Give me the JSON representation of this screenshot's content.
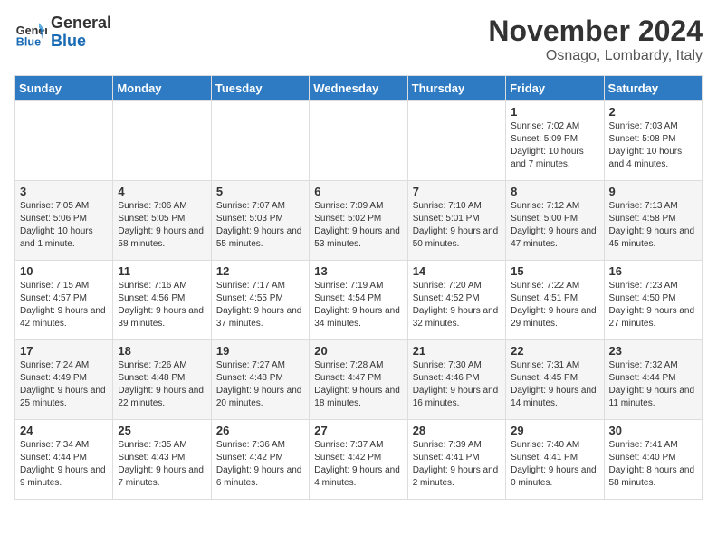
{
  "header": {
    "logo_general": "General",
    "logo_blue": "Blue",
    "month_title": "November 2024",
    "location": "Osnago, Lombardy, Italy"
  },
  "weekdays": [
    "Sunday",
    "Monday",
    "Tuesday",
    "Wednesday",
    "Thursday",
    "Friday",
    "Saturday"
  ],
  "weeks": [
    [
      {
        "day": "",
        "info": ""
      },
      {
        "day": "",
        "info": ""
      },
      {
        "day": "",
        "info": ""
      },
      {
        "day": "",
        "info": ""
      },
      {
        "day": "",
        "info": ""
      },
      {
        "day": "1",
        "info": "Sunrise: 7:02 AM\nSunset: 5:09 PM\nDaylight: 10 hours and 7 minutes."
      },
      {
        "day": "2",
        "info": "Sunrise: 7:03 AM\nSunset: 5:08 PM\nDaylight: 10 hours and 4 minutes."
      }
    ],
    [
      {
        "day": "3",
        "info": "Sunrise: 7:05 AM\nSunset: 5:06 PM\nDaylight: 10 hours and 1 minute."
      },
      {
        "day": "4",
        "info": "Sunrise: 7:06 AM\nSunset: 5:05 PM\nDaylight: 9 hours and 58 minutes."
      },
      {
        "day": "5",
        "info": "Sunrise: 7:07 AM\nSunset: 5:03 PM\nDaylight: 9 hours and 55 minutes."
      },
      {
        "day": "6",
        "info": "Sunrise: 7:09 AM\nSunset: 5:02 PM\nDaylight: 9 hours and 53 minutes."
      },
      {
        "day": "7",
        "info": "Sunrise: 7:10 AM\nSunset: 5:01 PM\nDaylight: 9 hours and 50 minutes."
      },
      {
        "day": "8",
        "info": "Sunrise: 7:12 AM\nSunset: 5:00 PM\nDaylight: 9 hours and 47 minutes."
      },
      {
        "day": "9",
        "info": "Sunrise: 7:13 AM\nSunset: 4:58 PM\nDaylight: 9 hours and 45 minutes."
      }
    ],
    [
      {
        "day": "10",
        "info": "Sunrise: 7:15 AM\nSunset: 4:57 PM\nDaylight: 9 hours and 42 minutes."
      },
      {
        "day": "11",
        "info": "Sunrise: 7:16 AM\nSunset: 4:56 PM\nDaylight: 9 hours and 39 minutes."
      },
      {
        "day": "12",
        "info": "Sunrise: 7:17 AM\nSunset: 4:55 PM\nDaylight: 9 hours and 37 minutes."
      },
      {
        "day": "13",
        "info": "Sunrise: 7:19 AM\nSunset: 4:54 PM\nDaylight: 9 hours and 34 minutes."
      },
      {
        "day": "14",
        "info": "Sunrise: 7:20 AM\nSunset: 4:52 PM\nDaylight: 9 hours and 32 minutes."
      },
      {
        "day": "15",
        "info": "Sunrise: 7:22 AM\nSunset: 4:51 PM\nDaylight: 9 hours and 29 minutes."
      },
      {
        "day": "16",
        "info": "Sunrise: 7:23 AM\nSunset: 4:50 PM\nDaylight: 9 hours and 27 minutes."
      }
    ],
    [
      {
        "day": "17",
        "info": "Sunrise: 7:24 AM\nSunset: 4:49 PM\nDaylight: 9 hours and 25 minutes."
      },
      {
        "day": "18",
        "info": "Sunrise: 7:26 AM\nSunset: 4:48 PM\nDaylight: 9 hours and 22 minutes."
      },
      {
        "day": "19",
        "info": "Sunrise: 7:27 AM\nSunset: 4:48 PM\nDaylight: 9 hours and 20 minutes."
      },
      {
        "day": "20",
        "info": "Sunrise: 7:28 AM\nSunset: 4:47 PM\nDaylight: 9 hours and 18 minutes."
      },
      {
        "day": "21",
        "info": "Sunrise: 7:30 AM\nSunset: 4:46 PM\nDaylight: 9 hours and 16 minutes."
      },
      {
        "day": "22",
        "info": "Sunrise: 7:31 AM\nSunset: 4:45 PM\nDaylight: 9 hours and 14 minutes."
      },
      {
        "day": "23",
        "info": "Sunrise: 7:32 AM\nSunset: 4:44 PM\nDaylight: 9 hours and 11 minutes."
      }
    ],
    [
      {
        "day": "24",
        "info": "Sunrise: 7:34 AM\nSunset: 4:44 PM\nDaylight: 9 hours and 9 minutes."
      },
      {
        "day": "25",
        "info": "Sunrise: 7:35 AM\nSunset: 4:43 PM\nDaylight: 9 hours and 7 minutes."
      },
      {
        "day": "26",
        "info": "Sunrise: 7:36 AM\nSunset: 4:42 PM\nDaylight: 9 hours and 6 minutes."
      },
      {
        "day": "27",
        "info": "Sunrise: 7:37 AM\nSunset: 4:42 PM\nDaylight: 9 hours and 4 minutes."
      },
      {
        "day": "28",
        "info": "Sunrise: 7:39 AM\nSunset: 4:41 PM\nDaylight: 9 hours and 2 minutes."
      },
      {
        "day": "29",
        "info": "Sunrise: 7:40 AM\nSunset: 4:41 PM\nDaylight: 9 hours and 0 minutes."
      },
      {
        "day": "30",
        "info": "Sunrise: 7:41 AM\nSunset: 4:40 PM\nDaylight: 8 hours and 58 minutes."
      }
    ]
  ]
}
